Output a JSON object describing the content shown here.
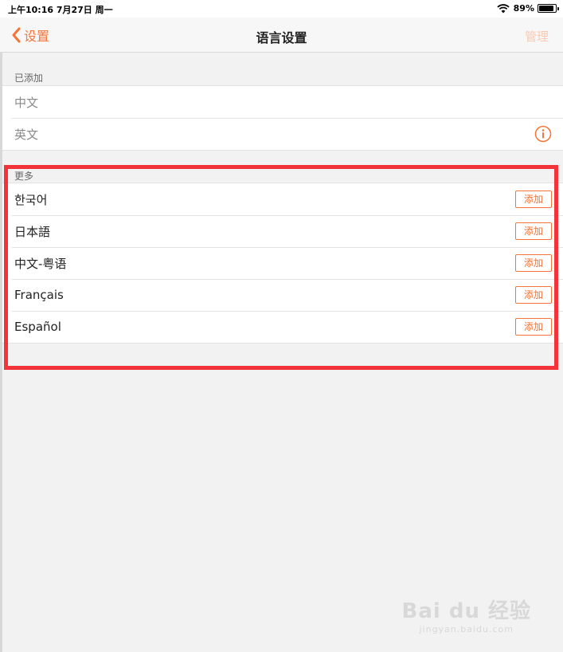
{
  "status_bar": {
    "time_date": "上午10:16   7月27日 周一",
    "battery": "89%",
    "battery_level": 0.89
  },
  "nav": {
    "back_label": "设置",
    "title": "语言设置",
    "manage_label": "管理"
  },
  "added_section": {
    "header": "已添加",
    "items": [
      {
        "label": "中文"
      },
      {
        "label": "英文"
      }
    ]
  },
  "more_section": {
    "header": "更多",
    "add_label": "添加",
    "items": [
      {
        "label": "한국어"
      },
      {
        "label": "日本語"
      },
      {
        "label": "中文-粤语"
      },
      {
        "label": "Français"
      },
      {
        "label": "Español"
      }
    ]
  },
  "watermark": {
    "logo": "Bai du 经验",
    "url": "jingyan.baidu.com"
  },
  "colors": {
    "accent": "#f5743a",
    "highlight": "#f2343a"
  }
}
